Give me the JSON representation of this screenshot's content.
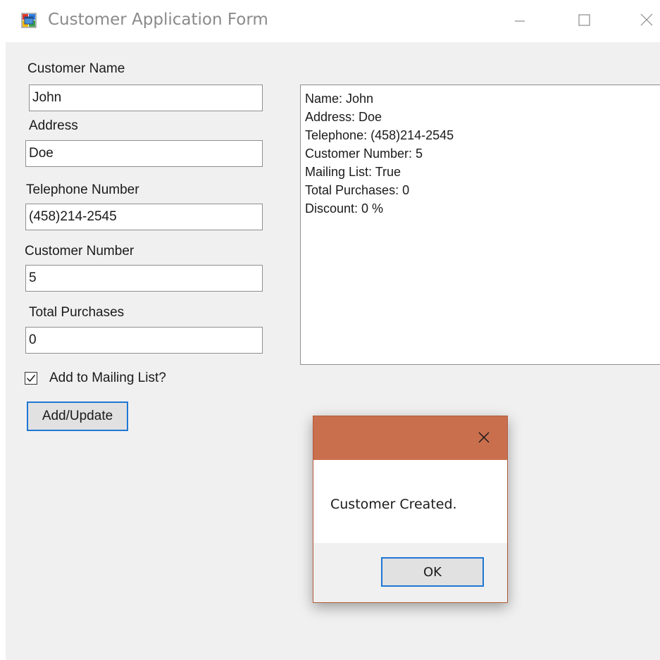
{
  "window": {
    "title": "Customer Application Form",
    "icon": "windows-form-app-icon",
    "controls": [
      "minimize-icon",
      "maximize-icon",
      "close-icon"
    ]
  },
  "form": {
    "customer_name": {
      "label": "Customer Name",
      "value": "John"
    },
    "address": {
      "label": "Address",
      "value": "Doe"
    },
    "telephone": {
      "label": "Telephone Number",
      "value": "(458)214-2545"
    },
    "customer_number": {
      "label": "Customer Number",
      "value": "5"
    },
    "total_purchases": {
      "label": "Total Purchases",
      "value": "0"
    },
    "mailing_list": {
      "label": "Add to Mailing List?",
      "checked": true
    },
    "add_button": "Add/Update"
  },
  "output": {
    "lines": [
      "Name: John",
      "Address: Doe",
      "Telephone: (458)214-2545",
      "Customer Number: 5",
      "Mailing List: True",
      "Total Purchases: 0",
      "Discount: 0 %"
    ]
  },
  "dialog": {
    "message": "Customer Created.",
    "ok_label": "OK",
    "header_color": "#c96f4e",
    "close_icon": "close-icon"
  },
  "colors": {
    "accent_focus": "#1e77d4",
    "window_bg": "#f0f0f0"
  }
}
